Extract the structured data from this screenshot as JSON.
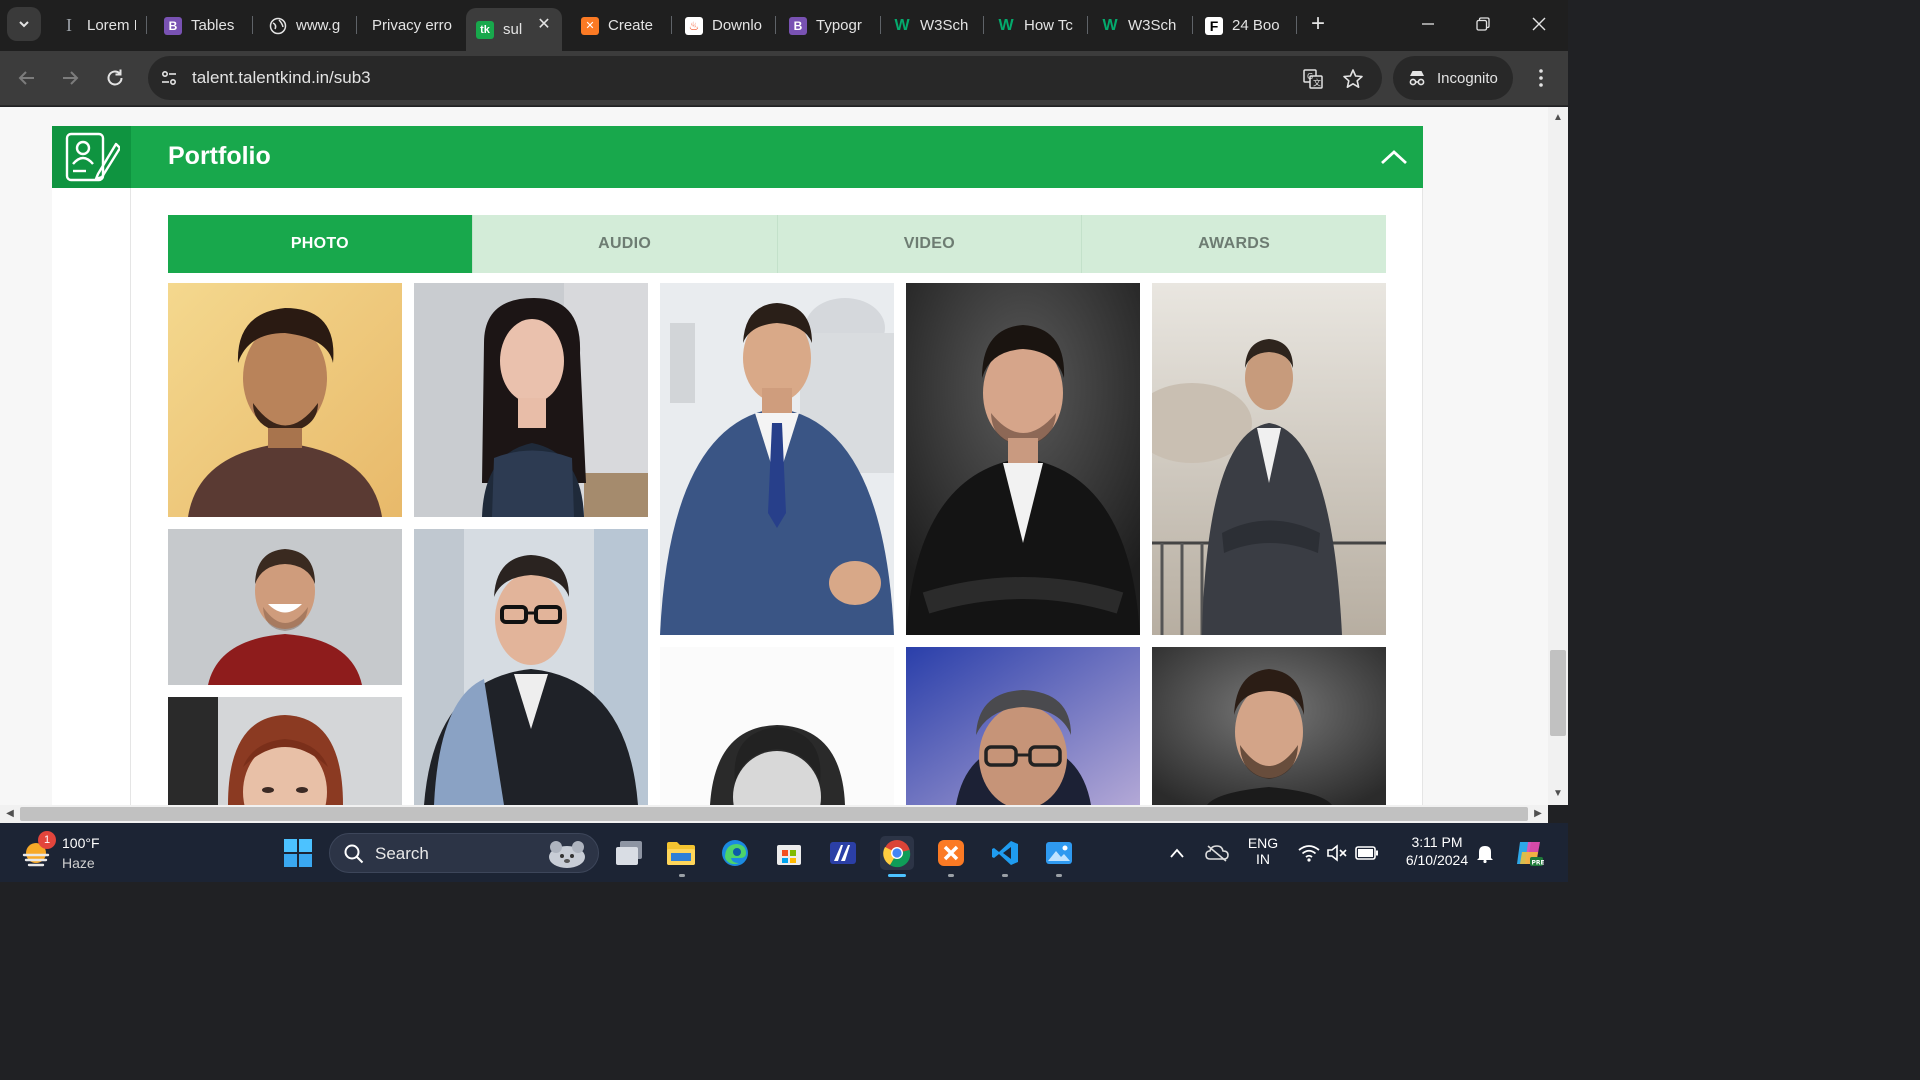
{
  "browser": {
    "tabs": [
      {
        "label": "Lorem I",
        "icon": "lorem-ipsum-icon",
        "color": "#3a3a3a"
      },
      {
        "label": "Tables",
        "icon": "bootstrap-icon",
        "color": "#7952b3"
      },
      {
        "label": "www.g",
        "icon": "globe-icon",
        "color": "#5f6368"
      },
      {
        "label": "Privacy erro",
        "icon": "warning-icon",
        "color": "#3c3c3c"
      },
      {
        "label": "sul",
        "icon": "talentkind-icon",
        "color": "#18a84c",
        "active": true
      },
      {
        "label": "Create",
        "icon": "xampp-icon",
        "color": "#fb7a24"
      },
      {
        "label": "Downlo",
        "icon": "fire-icon",
        "color": "#f25022"
      },
      {
        "label": "Typogr",
        "icon": "bootstrap-icon",
        "color": "#7952b3"
      },
      {
        "label": "W3Sch",
        "icon": "w3schools-icon",
        "color": "#04aa6d"
      },
      {
        "label": "How Tc",
        "icon": "w3schools-icon",
        "color": "#04aa6d"
      },
      {
        "label": "W3Sch",
        "icon": "w3schools-icon",
        "color": "#04aa6d"
      },
      {
        "label": "24 Boo",
        "icon": "f-letter-icon",
        "color": "#ffffff"
      }
    ],
    "url": "talent.talentkind.in/sub3",
    "incognito_label": "Incognito"
  },
  "page": {
    "section_title": "Portfolio",
    "accent_color": "#18a84c",
    "tabs": [
      "PHOTO",
      "AUDIO",
      "VIDEO",
      "AWARDS"
    ],
    "active_tab": "PHOTO",
    "photos": [
      {
        "alt": "man-curly-hair-maroon-shirt"
      },
      {
        "alt": "woman-dark-hair-lace-top"
      },
      {
        "alt": "man-blue-suit-city"
      },
      {
        "alt": "man-black-suit-dark-bg"
      },
      {
        "alt": "man-suit-arms-crossed-outdoor"
      },
      {
        "alt": "man-smiling-red-polo"
      },
      {
        "alt": "man-glasses-blazer"
      },
      {
        "alt": "woman-red-hair"
      },
      {
        "alt": "man-curly-hair-bw"
      },
      {
        "alt": "man-glasses-purple-bg"
      },
      {
        "alt": "man-beard-dark-bg"
      }
    ]
  },
  "taskbar": {
    "weather_temp": "100°F",
    "weather_desc": "Haze",
    "weather_badge": "1",
    "search_label": "Search",
    "lang_top": "ENG",
    "lang_bottom": "IN",
    "time": "3:11 PM",
    "date": "6/10/2024"
  }
}
